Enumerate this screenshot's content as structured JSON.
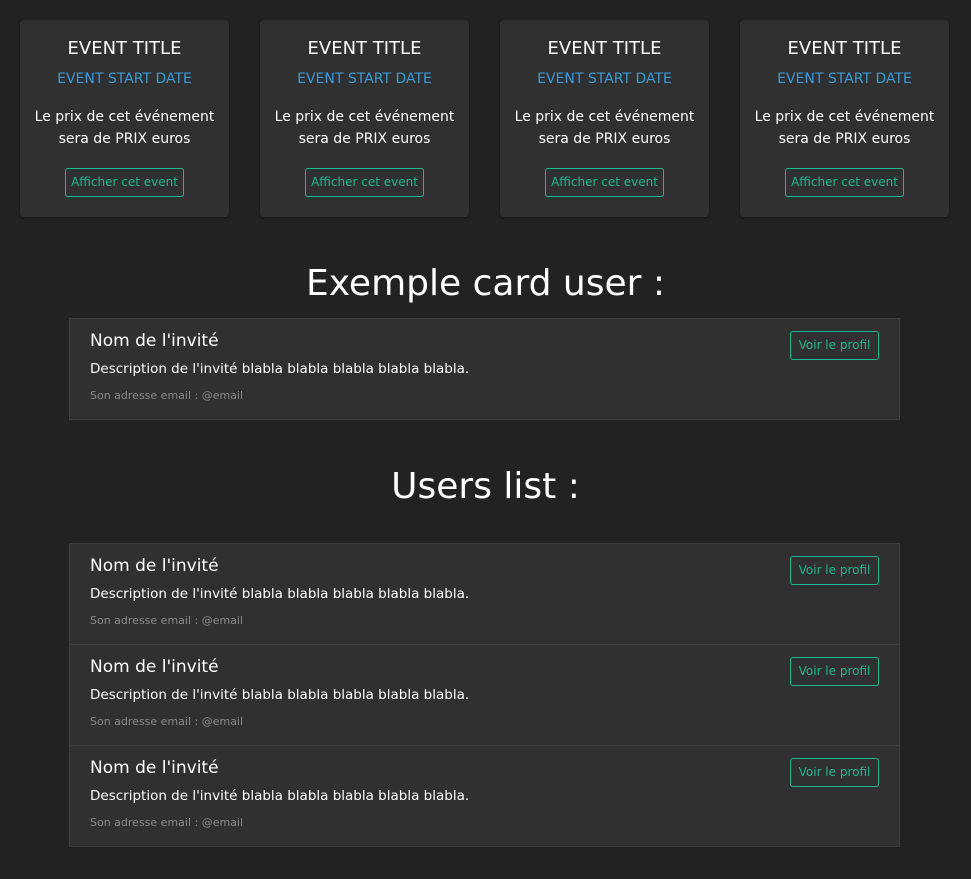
{
  "events": [
    {
      "title": "EVENT TITLE",
      "start_date": "EVENT START DATE",
      "price_text": "Le prix de cet événement sera de PRIX euros",
      "button_label": "Afficher cet event"
    },
    {
      "title": "EVENT TITLE",
      "start_date": "EVENT START DATE",
      "price_text": "Le prix de cet événement sera de PRIX euros",
      "button_label": "Afficher cet event"
    },
    {
      "title": "EVENT TITLE",
      "start_date": "EVENT START DATE",
      "price_text": "Le prix de cet événement sera de PRIX euros",
      "button_label": "Afficher cet event"
    },
    {
      "title": "EVENT TITLE",
      "start_date": "EVENT START DATE",
      "price_text": "Le prix de cet événement sera de PRIX euros",
      "button_label": "Afficher cet event"
    }
  ],
  "example_section": {
    "heading": "Exemple card user :",
    "user": {
      "name": "Nom de l'invité",
      "description": "Description de l'invité blabla blabla blabla blabla blabla.",
      "email": "Son adresse email : @email",
      "button_label": "Voir le profil"
    }
  },
  "users_section": {
    "heading": "Users list :",
    "users": [
      {
        "name": "Nom de l'invité",
        "description": "Description de l'invité blabla blabla blabla blabla blabla.",
        "email": "Son adresse email : @email",
        "button_label": "Voir le profil"
      },
      {
        "name": "Nom de l'invité",
        "description": "Description de l'invité blabla blabla blabla blabla blabla.",
        "email": "Son adresse email : @email",
        "button_label": "Voir le profil"
      },
      {
        "name": "Nom de l'invité",
        "description": "Description de l'invité blabla blabla blabla blabla blabla.",
        "email": "Son adresse email : @email",
        "button_label": "Voir le profil"
      }
    ]
  },
  "colors": {
    "background": "#222222",
    "card": "#303030",
    "date_accent": "#3a9ad9",
    "button_accent": "#1cb88e",
    "email_text": "#8a8a8a"
  }
}
